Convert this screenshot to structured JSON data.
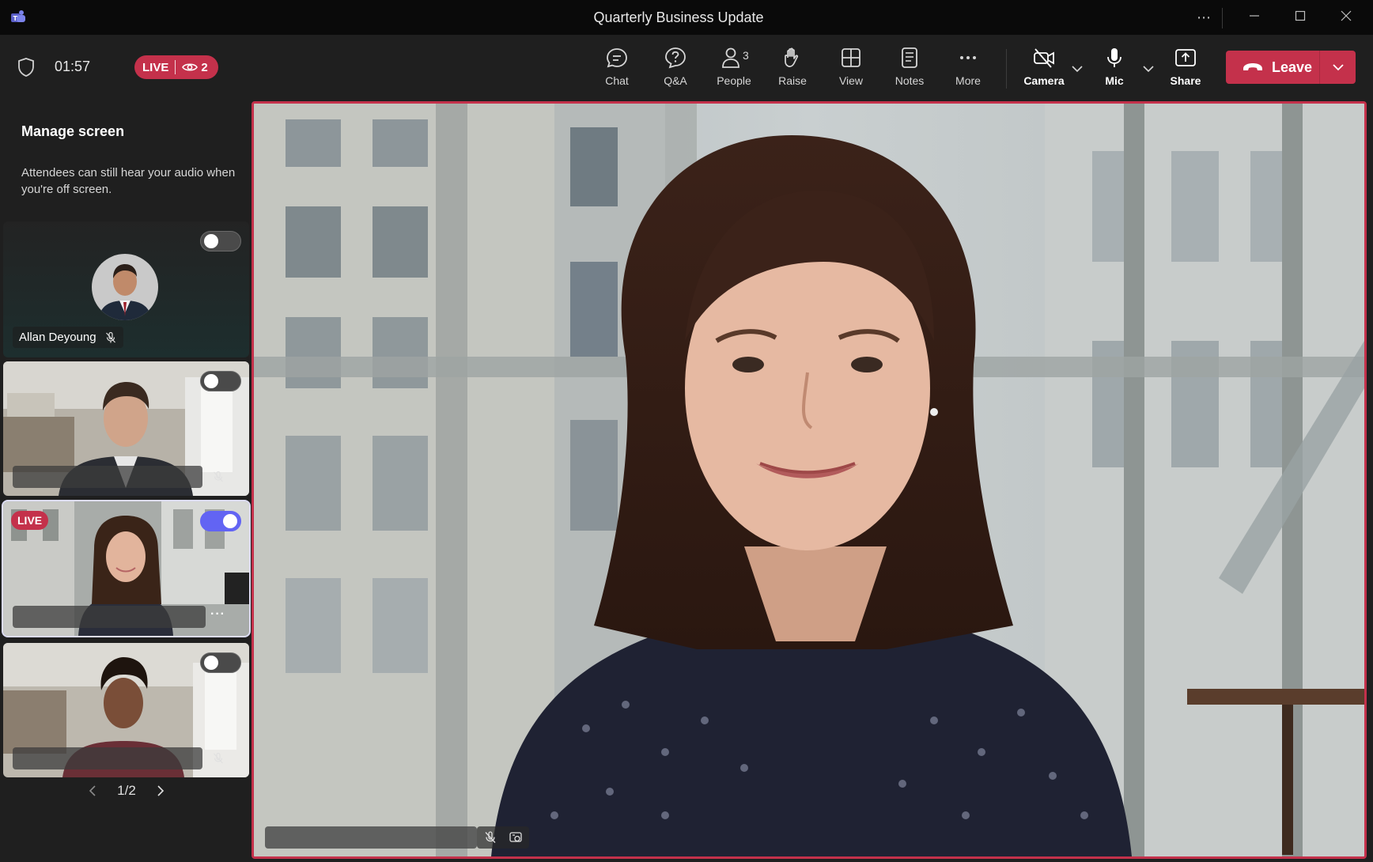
{
  "window": {
    "title": "Quarterly Business Update",
    "controls": [
      "more-options",
      "minimize",
      "maximize",
      "close"
    ]
  },
  "meeting": {
    "timer": "01:57",
    "live_label": "LIVE",
    "viewer_count": "2"
  },
  "toolbar": {
    "chat": "Chat",
    "qa": "Q&A",
    "people": "People",
    "people_count": "3",
    "raise": "Raise",
    "view": "View",
    "notes": "Notes",
    "more": "More",
    "camera": "Camera",
    "mic": "Mic",
    "share": "Share",
    "leave": "Leave"
  },
  "panel": {
    "title": "Manage screen",
    "description": "Attendees can still hear your audio when you're off screen.",
    "tiles": [
      {
        "name": "Allan Deyoung",
        "on_screen": false,
        "muted": true,
        "live": false
      },
      {
        "name": "",
        "on_screen": false,
        "muted": true,
        "live": false
      },
      {
        "name": "",
        "on_screen": true,
        "muted": false,
        "live": true,
        "live_label": "LIVE"
      },
      {
        "name": "",
        "on_screen": false,
        "muted": true,
        "live": false
      }
    ],
    "pager": "1/2"
  },
  "colors": {
    "accent_red": "#c4314b",
    "toggle_on": "#6264f3",
    "background": "#1f1f1f"
  }
}
